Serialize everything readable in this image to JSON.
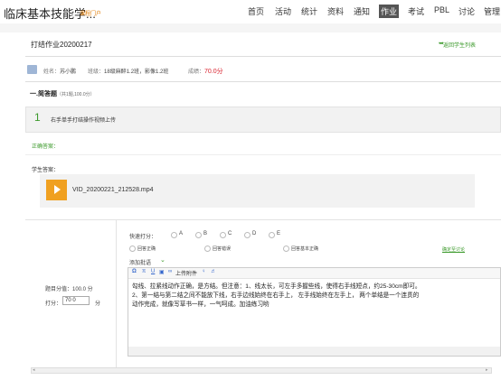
{
  "header": {
    "site_title": "临床基本技能学...",
    "portal": "课程门户",
    "nav": [
      "首页",
      "活动",
      "统计",
      "资料",
      "通知",
      "作业",
      "考试",
      "PBL",
      "讨论",
      "管理"
    ],
    "active_nav": "作业"
  },
  "page": {
    "title": "打结作业20200217",
    "back_label": "返回学生列表"
  },
  "student": {
    "name_label": "姓名：",
    "name": "苏小鹏",
    "class_label": "班级：",
    "class": "18级麻醉1.2班，影像1.2班",
    "score_label": "成绩：",
    "score": "70.0分"
  },
  "section": {
    "title": "一.简答题",
    "subtitle": "（共1题,100.0分）"
  },
  "question": {
    "number": "1",
    "text": "右手单手打结操作视频上传",
    "correct_label": "正确答案：",
    "student_label": "学生答案：",
    "file_name": "VID_20200221_212528.mp4"
  },
  "grading": {
    "full_score": "题目分值：100.0 分",
    "score_label": "打分：",
    "score_value": "70 0",
    "score_unit": "分",
    "quick_label": "快速打分：",
    "quick_options": [
      "A",
      "B",
      "C",
      "D",
      "E"
    ],
    "answer_options": [
      "回答正确",
      "回答错误",
      "回答基本正确"
    ],
    "sync_link": "确定至讨论",
    "add_comment": "添加批语",
    "toolbar": [
      "Ω",
      "π",
      "U",
      "▣",
      "∞",
      "上传附件",
      "♀",
      "♬"
    ],
    "comment": "勾线、拉紧线动作正确，是方结。但注意：1、线太长，可左手多握些线，使得右手线短点，约25-30cm即可。\n2、第一结与第二结之间不能放下线，右手边线始终在右手上， 左手线始终在左手上， 两个单结是一个连贯的\n动作完成，就像写草书一样，一气呵成。加油练习哟"
  },
  "colors": {
    "accent_green": "#3c9a2c",
    "score_red": "#d9232f",
    "file_icon_orange": "#f0a020"
  }
}
